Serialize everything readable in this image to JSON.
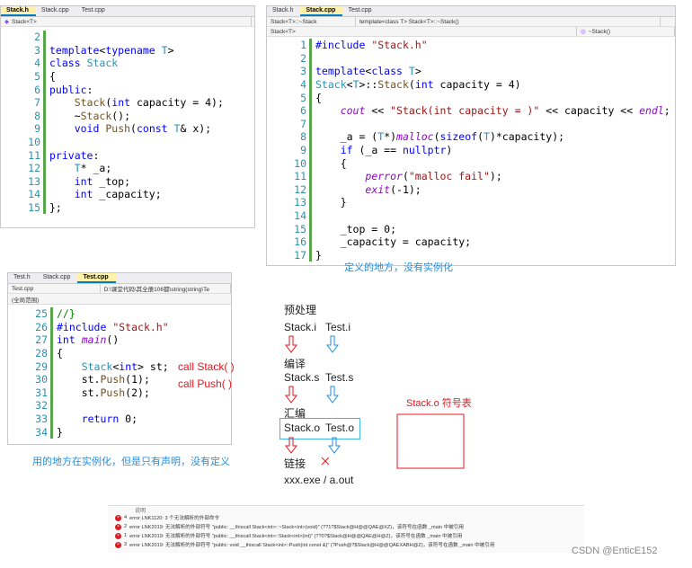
{
  "stack_h": {
    "tabs": [
      "Stack.h",
      "Stack.cpp",
      "Test.cpp"
    ],
    "active_tab": 0,
    "nav": [
      "Stack<T>"
    ],
    "lines": [
      {
        "n": "2",
        "t": []
      },
      {
        "n": "3",
        "t": [
          [
            "kw",
            "template"
          ],
          [
            "p",
            "<"
          ],
          [
            "kw",
            "typename"
          ],
          [
            "p",
            " "
          ],
          [
            "ty",
            "T"
          ],
          [
            "p",
            ">"
          ]
        ]
      },
      {
        "n": "4",
        "t": [
          [
            "kw",
            "class"
          ],
          [
            "p",
            " "
          ],
          [
            "ty",
            "Stack"
          ]
        ]
      },
      {
        "n": "5",
        "t": [
          [
            "p",
            "{"
          ]
        ]
      },
      {
        "n": "6",
        "t": [
          [
            "kw",
            "public"
          ],
          [
            "p",
            ":"
          ]
        ]
      },
      {
        "n": "7",
        "t": [
          [
            "p",
            "    "
          ],
          [
            "fn",
            "Stack"
          ],
          [
            "p",
            "("
          ],
          [
            "kw",
            "int"
          ],
          [
            "p",
            " capacity = 4);"
          ]
        ]
      },
      {
        "n": "8",
        "t": [
          [
            "p",
            "    ~"
          ],
          [
            "fn",
            "Stack"
          ],
          [
            "p",
            "();"
          ]
        ]
      },
      {
        "n": "9",
        "t": [
          [
            "p",
            "    "
          ],
          [
            "kw",
            "void"
          ],
          [
            "p",
            " "
          ],
          [
            "fn",
            "Push"
          ],
          [
            "p",
            "("
          ],
          [
            "kw",
            "const"
          ],
          [
            "p",
            " "
          ],
          [
            "ty",
            "T"
          ],
          [
            "p",
            "& x);"
          ]
        ]
      },
      {
        "n": "10",
        "t": []
      },
      {
        "n": "11",
        "t": [
          [
            "kw",
            "private"
          ],
          [
            "p",
            ":"
          ]
        ]
      },
      {
        "n": "12",
        "t": [
          [
            "p",
            "    "
          ],
          [
            "ty",
            "T"
          ],
          [
            "p",
            "* _a;"
          ]
        ]
      },
      {
        "n": "13",
        "t": [
          [
            "p",
            "    "
          ],
          [
            "kw",
            "int"
          ],
          [
            "p",
            " _top;"
          ]
        ]
      },
      {
        "n": "14",
        "t": [
          [
            "p",
            "    "
          ],
          [
            "kw",
            "int"
          ],
          [
            "p",
            " _capacity;"
          ]
        ]
      },
      {
        "n": "15",
        "t": [
          [
            "p",
            "};"
          ]
        ]
      }
    ]
  },
  "stack_cpp": {
    "tabs": [
      "Stack.h",
      "Stack.cpp",
      "Test.cpp"
    ],
    "active_tab": 1,
    "nav": [
      "Stack<T>::~Stack",
      "template<class T> Stack<T>::~Stack()"
    ],
    "nav2": [
      "Stack<T>",
      "~Stack()"
    ],
    "lines": [
      {
        "n": "1",
        "t": [
          [
            "kw",
            "#include"
          ],
          [
            "p",
            " "
          ],
          [
            "str",
            "\"Stack.h\""
          ]
        ]
      },
      {
        "n": "2",
        "t": []
      },
      {
        "n": "3",
        "t": [
          [
            "kw",
            "template"
          ],
          [
            "p",
            "<"
          ],
          [
            "kw",
            "class"
          ],
          [
            "p",
            " "
          ],
          [
            "ty",
            "T"
          ],
          [
            "p",
            ">"
          ]
        ]
      },
      {
        "n": "4",
        "t": [
          [
            "ty",
            "Stack"
          ],
          [
            "p",
            "<"
          ],
          [
            "ty",
            "T"
          ],
          [
            "p",
            ">::"
          ],
          [
            "fn",
            "Stack"
          ],
          [
            "p",
            "("
          ],
          [
            "kw",
            "int"
          ],
          [
            "p",
            " capacity = 4)"
          ]
        ]
      },
      {
        "n": "5",
        "t": [
          [
            "p",
            "{"
          ]
        ]
      },
      {
        "n": "6",
        "t": [
          [
            "p",
            "    "
          ],
          [
            "it",
            "cout"
          ],
          [
            "p",
            " << "
          ],
          [
            "str",
            "\"Stack(int capacity = )\""
          ],
          [
            "p",
            " << capacity << "
          ],
          [
            "it",
            "endl"
          ],
          [
            "p",
            ";"
          ]
        ]
      },
      {
        "n": "7",
        "t": []
      },
      {
        "n": "8",
        "t": [
          [
            "p",
            "    _a = ("
          ],
          [
            "ty",
            "T"
          ],
          [
            "p",
            "*)"
          ],
          [
            "it",
            "malloc"
          ],
          [
            "p",
            "("
          ],
          [
            "kw",
            "sizeof"
          ],
          [
            "p",
            "("
          ],
          [
            "ty",
            "T"
          ],
          [
            "p",
            ")*capacity);"
          ]
        ]
      },
      {
        "n": "9",
        "t": [
          [
            "p",
            "    "
          ],
          [
            "kw",
            "if"
          ],
          [
            "p",
            " (_a == "
          ],
          [
            "kw",
            "nullptr"
          ],
          [
            "p",
            ")"
          ]
        ]
      },
      {
        "n": "10",
        "t": [
          [
            "p",
            "    {"
          ]
        ]
      },
      {
        "n": "11",
        "t": [
          [
            "p",
            "        "
          ],
          [
            "it",
            "perror"
          ],
          [
            "p",
            "("
          ],
          [
            "str",
            "\"malloc fail\""
          ],
          [
            "p",
            ");"
          ]
        ]
      },
      {
        "n": "12",
        "t": [
          [
            "p",
            "        "
          ],
          [
            "it",
            "exit"
          ],
          [
            "p",
            "(-1);"
          ]
        ]
      },
      {
        "n": "13",
        "t": [
          [
            "p",
            "    }"
          ]
        ]
      },
      {
        "n": "14",
        "t": []
      },
      {
        "n": "15",
        "t": [
          [
            "p",
            "    _top = 0;"
          ]
        ]
      },
      {
        "n": "16",
        "t": [
          [
            "p",
            "    _capacity = capacity;"
          ]
        ]
      },
      {
        "n": "17",
        "t": [
          [
            "p",
            "}"
          ]
        ]
      }
    ]
  },
  "test_cpp": {
    "tabs": [
      "Test.h",
      "Stack.cpp",
      "Test.cpp"
    ],
    "active_tab": 2,
    "nav": [
      "Test.cpp",
      "D:\\课堂代码\\其全册106都\\string(string\\Te"
    ],
    "scope": "(全局范围)",
    "lines": [
      {
        "n": "25",
        "t": [
          [
            "cm",
            "//}"
          ]
        ]
      },
      {
        "n": "26",
        "t": [
          [
            "kw",
            "#include"
          ],
          [
            "p",
            " "
          ],
          [
            "str",
            "\"Stack.h\""
          ]
        ]
      },
      {
        "n": "27",
        "t": [
          [
            "kw",
            "int"
          ],
          [
            "p",
            " "
          ],
          [
            "it",
            "main"
          ],
          [
            "p",
            "()"
          ]
        ]
      },
      {
        "n": "28",
        "t": [
          [
            "p",
            "{"
          ]
        ]
      },
      {
        "n": "29",
        "t": [
          [
            "p",
            "    "
          ],
          [
            "ty",
            "Stack"
          ],
          [
            "p",
            "<"
          ],
          [
            "kw",
            "int"
          ],
          [
            "p",
            "> st;"
          ]
        ]
      },
      {
        "n": "30",
        "t": [
          [
            "p",
            "    st."
          ],
          [
            "fn",
            "Push"
          ],
          [
            "p",
            "(1);"
          ]
        ]
      },
      {
        "n": "31",
        "t": [
          [
            "p",
            "    st."
          ],
          [
            "fn",
            "Push"
          ],
          [
            "p",
            "(2);"
          ]
        ]
      },
      {
        "n": "32",
        "t": []
      },
      {
        "n": "33",
        "t": [
          [
            "p",
            "    "
          ],
          [
            "kw",
            "return"
          ],
          [
            "p",
            " 0;"
          ]
        ]
      },
      {
        "n": "34",
        "t": [
          [
            "p",
            "}"
          ]
        ]
      }
    ]
  },
  "annotations": {
    "defined_here": "定义的地方，没有实例化",
    "used_here": "用的地方在实例化，但是只有声明，没有定义",
    "call_stack": "call Stack(    )",
    "call_push": "call Push(    )",
    "preprocess": "预处理",
    "files_i": [
      "Stack.i",
      "Test.i"
    ],
    "compile": "编译",
    "files_s": [
      "Stack.s",
      "Test.s"
    ],
    "assemble": "汇编",
    "files_o": [
      "Stack.o",
      "Test.o"
    ],
    "link": "链接",
    "exe": "xxx.exe /   a.out",
    "symbol_table": "Stack.o 符号表"
  },
  "errors": {
    "header": "说明",
    "items": [
      {
        "num": "4",
        "text": "error LNK1120: 3 个无法解析的外部命令"
      },
      {
        "num": "2",
        "text": "error LNK2019: 无法解析的外部符号 \"public: __thiscall Stack<int>::~Stack<int>(void)\" (??1?$Stack@H@@QAE@XZ)，该符号在函数 _main 中被引用"
      },
      {
        "num": "1",
        "text": "error LNK2019: 无法解析的外部符号 \"public: __thiscall Stack<int>::Stack<int>(int)\" (??0?$Stack@H@@QAE@H@Z)，该符号在函数 _main 中被引用"
      },
      {
        "num": "3",
        "text": "error LNK2019: 无法解析的外部符号 \"public: void __thiscall Stack<int>::Push(int const &)\" (?Push@?$Stack@H@@QAEXABH@Z)，该符号在函数 _main 中被引用"
      }
    ]
  },
  "watermark": "CSDN @EnticE152",
  "colors": {
    "red": "#e0181f",
    "blue": "#1f8fe0",
    "keyword": "#0000ff",
    "type": "#2b91af"
  }
}
